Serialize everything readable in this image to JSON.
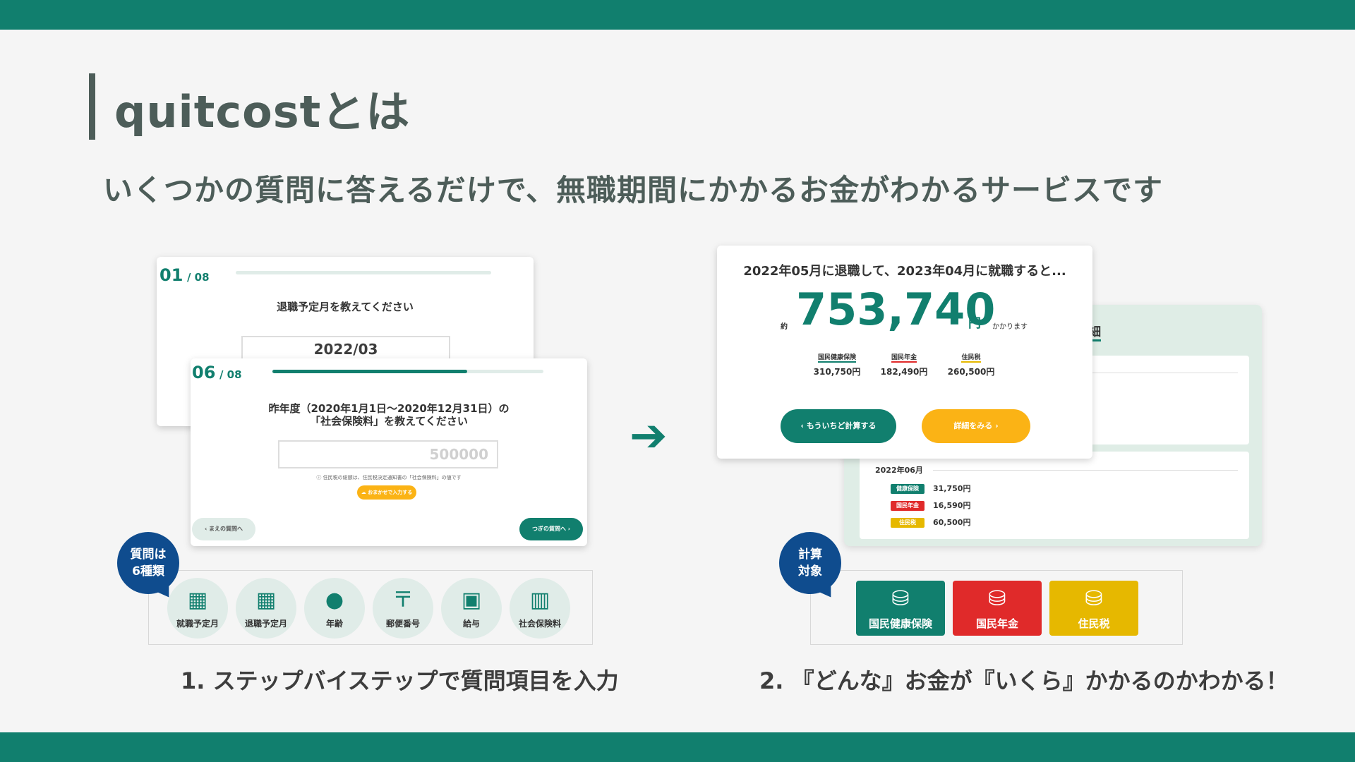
{
  "header": {
    "title": "quitcostとは",
    "subtitle": "いくつかの質問に答えるだけで、無職期間にかかるお金がわかるサービスです"
  },
  "left": {
    "card_back": {
      "step_current": "01",
      "step_total": "/ 08",
      "question": "退職予定月を教えてください",
      "value": "2022/03"
    },
    "card_front": {
      "step_current": "06",
      "step_total": "/ 08",
      "progress": 0.72,
      "question_line1": "昨年度（2020年1月1日～2020年12月31日）の",
      "question_line2": "「社会保険料」を教えてください",
      "placeholder": "500000",
      "note": "住民税の総額は、住民税決定通知書の「社会保険料」の値です",
      "auto_button": "おまかせで入力する",
      "prev_button": "まえの質問へ",
      "next_button": "つぎの質問へ"
    },
    "badge_line1": "質問は",
    "badge_line2": "6種類",
    "icons": [
      {
        "icon": "calendar-icon",
        "label": "就職予定月"
      },
      {
        "icon": "calendar-icon",
        "label": "退職予定月"
      },
      {
        "icon": "person-icon",
        "label": "年齢"
      },
      {
        "icon": "postal-icon",
        "label": "郵便番号"
      },
      {
        "icon": "money-icon",
        "label": "給与"
      },
      {
        "icon": "hospital-icon",
        "label": "社会保険料"
      }
    ],
    "caption": "1. ステップバイステップで質問項目を入力"
  },
  "right": {
    "result": {
      "headline": "2022年05月に退職して、2023年04月に就職すると...",
      "approx": "約",
      "amount": "753,740",
      "yen": "円",
      "suffix": "かかります",
      "breakdown": [
        {
          "label": "国民健康保険",
          "value": "310,750円",
          "color": "#117f6e"
        },
        {
          "label": "国民年金",
          "value": "182,490円",
          "color": "#e02a2a"
        },
        {
          "label": "住民税",
          "value": "260,500円",
          "color": "#e6b800"
        }
      ],
      "retry_button": "もういちど計算する",
      "detail_button": "詳細をみる"
    },
    "detail": {
      "tab": "詳細",
      "month": "2022年06月",
      "rows": [
        {
          "chip": "健康保険",
          "value": "31,750円",
          "color": "#117f6e"
        },
        {
          "chip": "国民年金",
          "value": "16,590円",
          "color": "#e02a2a"
        },
        {
          "chip": "住民税",
          "value": "60,500円",
          "color": "#e6b800"
        }
      ]
    },
    "badge_line1": "計算",
    "badge_line2": "対象",
    "categories": [
      {
        "label": "国民健康保険",
        "color": "#117f6e"
      },
      {
        "label": "国民年金",
        "color": "#e02a2a"
      },
      {
        "label": "住民税",
        "color": "#e6b800"
      }
    ],
    "caption": "2. 『どんな』お金が『いくら』かかるのかわかる！"
  },
  "colors": {
    "brand": "#117f6e",
    "accent_yellow": "#fbb315",
    "badge_blue": "#0f4c8e"
  }
}
